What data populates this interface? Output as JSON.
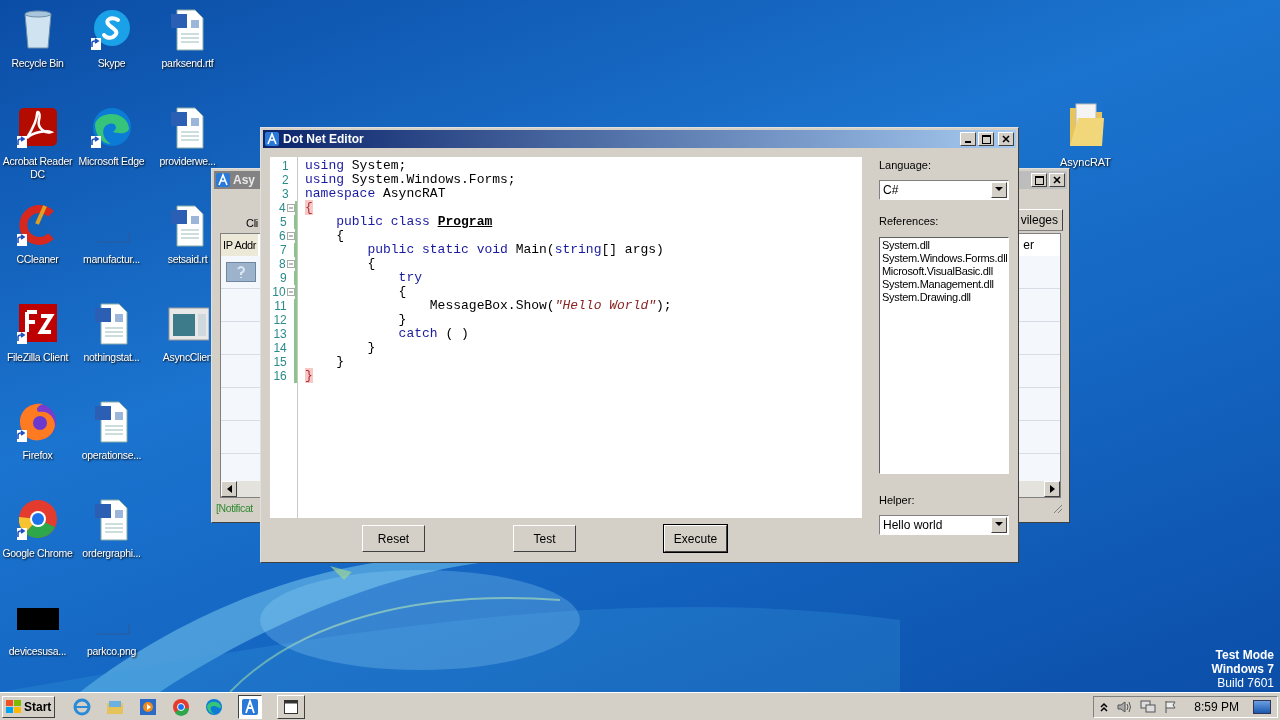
{
  "desktop_icons": [
    {
      "label": "Recycle Bin",
      "kind": "recycle",
      "shortcut": false
    },
    {
      "label": "Acrobat Reader DC",
      "kind": "pdf",
      "shortcut": true
    },
    {
      "label": "CCleaner",
      "kind": "ccleaner",
      "shortcut": true
    },
    {
      "label": "FileZilla Client",
      "kind": "filezilla",
      "shortcut": true
    },
    {
      "label": "Firefox",
      "kind": "firefox",
      "shortcut": true
    },
    {
      "label": "Google Chrome",
      "kind": "chrome",
      "shortcut": true
    },
    {
      "label": "devicesusa...",
      "kind": "black",
      "shortcut": false
    },
    {
      "label": "Skype",
      "kind": "skype",
      "shortcut": true
    },
    {
      "label": "Microsoft Edge",
      "kind": "edge",
      "shortcut": true
    },
    {
      "label": "manufactur...",
      "kind": "blank",
      "shortcut": false
    },
    {
      "label": "nothingstat...",
      "kind": "word",
      "shortcut": false
    },
    {
      "label": "operationse...",
      "kind": "word",
      "shortcut": false
    },
    {
      "label": "ordergraphi...",
      "kind": "word",
      "shortcut": false
    },
    {
      "label": "parkco.png",
      "kind": "blank",
      "shortcut": false
    },
    {
      "label": "parksend.rtf",
      "kind": "word",
      "shortcut": false
    },
    {
      "label": "providerwe...",
      "kind": "word",
      "shortcut": false
    },
    {
      "label": "setsaid.rt",
      "kind": "word",
      "shortcut": false
    },
    {
      "label": "AsyncClien",
      "kind": "window",
      "shortcut": false
    }
  ],
  "folder_icon": {
    "label": "AsyncRAT"
  },
  "background_window": {
    "title": "Asy",
    "tab_left": "Cli",
    "tab_right": "vileges",
    "column_left": "IP Addr",
    "column_right": "er",
    "status": "[Notificat"
  },
  "editor": {
    "title": "Dot Net Editor",
    "lines": [
      {
        "number": "1",
        "fold": false,
        "changed": false,
        "tokens": [
          {
            "text": "using",
            "kind": "keyword"
          },
          {
            "text": " System;",
            "kind": "plain"
          }
        ]
      },
      {
        "number": "2",
        "fold": false,
        "changed": false,
        "tokens": [
          {
            "text": "using",
            "kind": "keyword"
          },
          {
            "text": " System.Windows.Forms;",
            "kind": "plain"
          }
        ]
      },
      {
        "number": "3",
        "fold": false,
        "changed": false,
        "tokens": [
          {
            "text": "namespace",
            "kind": "keyword"
          },
          {
            "text": " AsyncRAT",
            "kind": "plain"
          }
        ]
      },
      {
        "number": "4",
        "fold": true,
        "changed": true,
        "tokens": [
          {
            "text": "{",
            "kind": "brace_match"
          }
        ]
      },
      {
        "number": "5",
        "fold": false,
        "changed": true,
        "tokens": [
          {
            "text": "    public class ",
            "kind": "keyword"
          },
          {
            "text": "Program",
            "kind": "type_name"
          }
        ]
      },
      {
        "number": "6",
        "fold": true,
        "changed": true,
        "tokens": [
          {
            "text": "    {",
            "kind": "plain"
          }
        ]
      },
      {
        "number": "7",
        "fold": false,
        "changed": true,
        "tokens": [
          {
            "text": "        public static void",
            "kind": "keyword"
          },
          {
            "text": " Main(",
            "kind": "plain"
          },
          {
            "text": "string",
            "kind": "keyword"
          },
          {
            "text": "[] args)",
            "kind": "plain"
          }
        ]
      },
      {
        "number": "8",
        "fold": true,
        "changed": true,
        "tokens": [
          {
            "text": "        {",
            "kind": "plain"
          }
        ]
      },
      {
        "number": "9",
        "fold": false,
        "changed": true,
        "tokens": [
          {
            "text": "            try",
            "kind": "keyword"
          }
        ]
      },
      {
        "number": "10",
        "fold": true,
        "changed": true,
        "tokens": [
          {
            "text": "            {",
            "kind": "plain"
          }
        ]
      },
      {
        "number": "11",
        "fold": false,
        "changed": true,
        "tokens": [
          {
            "text": "                MessageBox.Show(",
            "kind": "plain"
          },
          {
            "text": "\"Hello World\"",
            "kind": "string"
          },
          {
            "text": ");",
            "kind": "plain"
          }
        ]
      },
      {
        "number": "12",
        "fold": false,
        "changed": true,
        "tokens": [
          {
            "text": "            }",
            "kind": "plain"
          }
        ]
      },
      {
        "number": "13",
        "fold": false,
        "changed": true,
        "tokens": [
          {
            "text": "            catch",
            "kind": "keyword"
          },
          {
            "text": " ( )",
            "kind": "plain"
          }
        ]
      },
      {
        "number": "14",
        "fold": false,
        "changed": true,
        "tokens": [
          {
            "text": "        }",
            "kind": "plain"
          }
        ]
      },
      {
        "number": "15",
        "fold": false,
        "changed": true,
        "tokens": [
          {
            "text": "    }",
            "kind": "plain"
          }
        ]
      },
      {
        "number": "16",
        "fold": false,
        "changed": true,
        "tokens": [
          {
            "text": "}",
            "kind": "brace_match"
          }
        ]
      }
    ],
    "buttons": [
      {
        "label": "Reset",
        "default": false
      },
      {
        "label": "Test",
        "default": false
      },
      {
        "label": "Execute",
        "default": true
      }
    ],
    "language": {
      "label": "Language:",
      "value": "C#"
    },
    "references": {
      "label": "References:",
      "items": [
        "System.dll",
        "System.Windows.Forms.dll",
        "Microsoft.VisualBasic.dll",
        "System.Management.dll",
        "System.Drawing.dll"
      ]
    },
    "helper": {
      "label": "Helper:",
      "value": "Hello world"
    }
  },
  "system_notice": [
    "Test Mode",
    "Windows 7",
    "Build 7601"
  ],
  "taskbar": {
    "start": "Start",
    "clock": "8:59 PM"
  }
}
